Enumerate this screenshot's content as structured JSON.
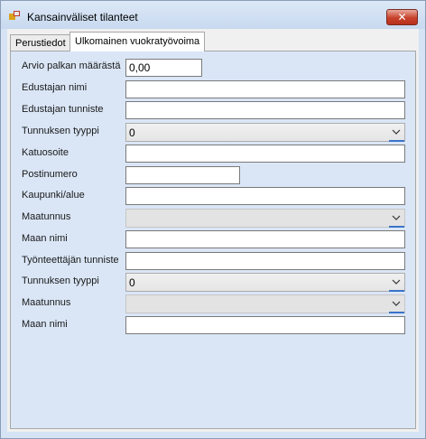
{
  "window": {
    "title": "Kansainväliset tilanteet",
    "close_label": "✕"
  },
  "tabs": [
    {
      "label": "Perustiedot",
      "active": false
    },
    {
      "label": "Ulkomainen vuokratyövoima",
      "active": true
    }
  ],
  "form": {
    "fields": [
      {
        "label": "Arvio palkan määrästä",
        "type": "text",
        "value": "0,00"
      },
      {
        "label": "Edustajan nimi",
        "type": "text",
        "value": ""
      },
      {
        "label": "Edustajan tunniste",
        "type": "text",
        "value": ""
      },
      {
        "label": "Tunnuksen tyyppi",
        "type": "select",
        "value": "0",
        "enabled": true
      },
      {
        "label": "Katuosoite",
        "type": "text",
        "value": ""
      },
      {
        "label": "Postinumero",
        "type": "text",
        "value": ""
      },
      {
        "label": "Kaupunki/alue",
        "type": "text",
        "value": ""
      },
      {
        "label": "Maatunnus",
        "type": "select",
        "value": "",
        "enabled": false
      },
      {
        "label": "Maan nimi",
        "type": "text",
        "value": ""
      },
      {
        "label": "Työnteettäjän tunniste",
        "type": "text",
        "value": ""
      },
      {
        "label": "Tunnuksen tyyppi",
        "type": "select",
        "value": "0",
        "enabled": true
      },
      {
        "label": "Maatunnus",
        "type": "select",
        "value": "",
        "enabled": false
      },
      {
        "label": "Maan nimi",
        "type": "text",
        "value": ""
      }
    ]
  },
  "colors": {
    "panel_background": "#dae6f6",
    "close_button": "#c7422c",
    "combo_accent": "#3a74c8"
  }
}
